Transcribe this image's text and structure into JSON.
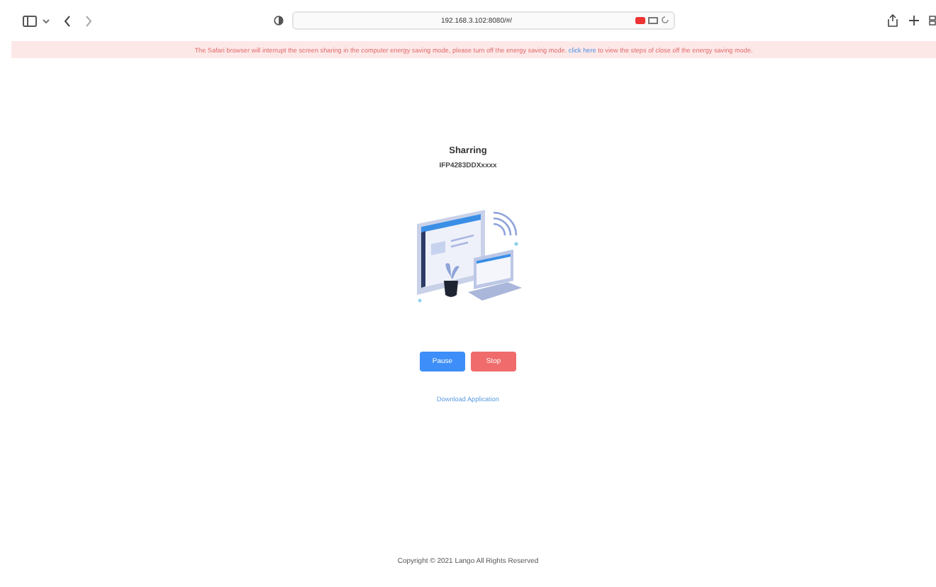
{
  "browser": {
    "address": "192.168.3.102:8080/#/"
  },
  "banner": {
    "before": "The Safari browser will interrupt the screen sharing in the computer energy saving mode, please turn off the energy saving mode.",
    "link": "click here",
    "after": "to view the steps of close off the energy saving mode."
  },
  "title": "Sharring",
  "device_id": "IFP4283DDXxxxx",
  "buttons": [
    {
      "label": "Pause",
      "kind": "primary"
    },
    {
      "label": "Stop",
      "kind": "danger"
    }
  ],
  "download_link": "Download Application",
  "footer": "Copyright © 2021 Lango All Rights Reserved"
}
